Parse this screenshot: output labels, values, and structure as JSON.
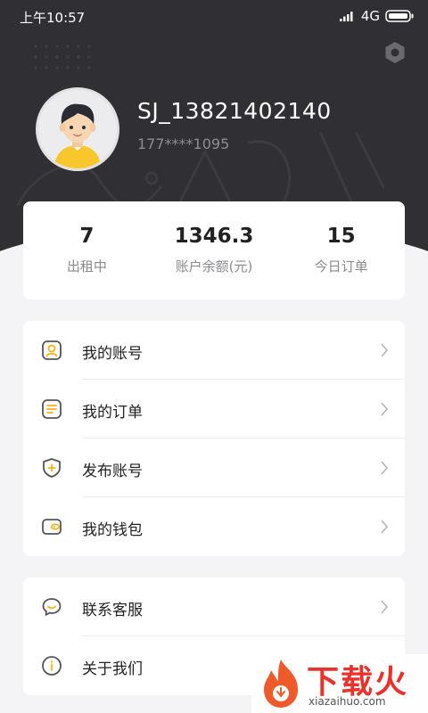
{
  "status_bar": {
    "time": "上午10:57",
    "network": "4G"
  },
  "profile": {
    "username": "SJ_13821402140",
    "phone": "177****1095"
  },
  "stats": [
    {
      "value": "7",
      "label": "出租中"
    },
    {
      "value": "1346.3",
      "label": "账户余额(元)"
    },
    {
      "value": "15",
      "label": "今日订单"
    }
  ],
  "menu_main": [
    {
      "label": "我的账号",
      "icon": "user-icon"
    },
    {
      "label": "我的订单",
      "icon": "order-list-icon"
    },
    {
      "label": "发布账号",
      "icon": "publish-shield-icon"
    },
    {
      "label": "我的钱包",
      "icon": "wallet-icon"
    }
  ],
  "menu_other": [
    {
      "label": "联系客服",
      "icon": "chat-icon"
    },
    {
      "label": "关于我们",
      "icon": "info-icon"
    }
  ],
  "watermark": {
    "title": "下载火",
    "subtitle": "xiazaihuo.com"
  },
  "colors": {
    "header_bg": "#303034",
    "accent": "#f5b418",
    "page_bg": "#f4f4f6"
  }
}
